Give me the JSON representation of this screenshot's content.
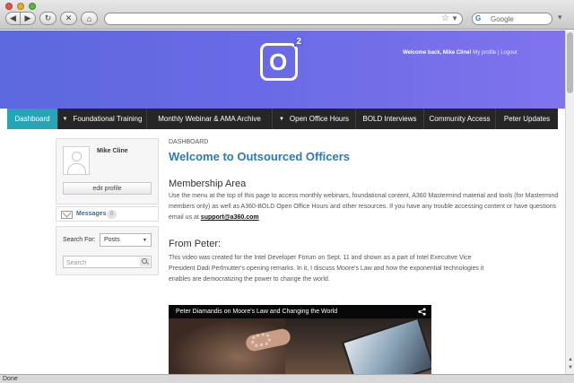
{
  "browser": {
    "search_placeholder": "Google",
    "status_text": "Done"
  },
  "header": {
    "logo_text": "O",
    "logo_sup": "2",
    "welcome_text": "Welcome back, Mike Cline!",
    "my_profile_link": "My profile",
    "separator": "|",
    "logout_link": "Logout"
  },
  "nav": {
    "items": [
      {
        "label": "Dashboard",
        "has_dropdown": false,
        "active": true
      },
      {
        "label": "Foundational Training",
        "has_dropdown": true,
        "active": false
      },
      {
        "label": "Monthly Webinar & AMA Archive",
        "has_dropdown": false,
        "active": false
      },
      {
        "label": "Open Office Hours",
        "has_dropdown": true,
        "active": false
      },
      {
        "label": "BOLD Interviews",
        "has_dropdown": false,
        "active": false
      },
      {
        "label": "Community Access",
        "has_dropdown": false,
        "active": false
      },
      {
        "label": "Peter Updates",
        "has_dropdown": false,
        "active": false
      }
    ]
  },
  "sidebar": {
    "profile_name": "Mike Cline",
    "edit_profile_label": "edit profile",
    "messages_label": "Messages",
    "messages_count": "0",
    "search_for_label": "Search For:",
    "search_type_selected": "Posts",
    "search_placeholder": "Search"
  },
  "content": {
    "breadcrumb": "DASHBOARD",
    "title": "Welcome to Outsourced Officers",
    "membership_heading": "Membership Area",
    "membership_text": "Use the menu at the top of this page to access monthly webinars, foundational content, A360 Mastermind material and tools (for Mastermind members only) as well as A360-BOLD Open Office Hours and other resources. If you have any trouble accessing content or have questions email us at ",
    "membership_email": "support@a360.com",
    "peter_heading": "From Peter:",
    "peter_text": "This video was created for the Intel Developer Forum on Sept. 11 and shown as a part of Intel Executive Vice President Dadi Perlmutter's opening remarks. In it, I discuss Moore's Law and how the exponential technologies it enables are democratizing the power to change the world.",
    "video_title": "Peter Diamandis on Moore's Law and Changing the World"
  },
  "colors": {
    "header_gradient_start": "#5c68dd",
    "header_gradient_end": "#7f74ec",
    "nav_background": "#262626",
    "nav_active": "#27a5b8",
    "title_blue": "#2c7ab7",
    "link_blue": "#2a6fb8"
  }
}
